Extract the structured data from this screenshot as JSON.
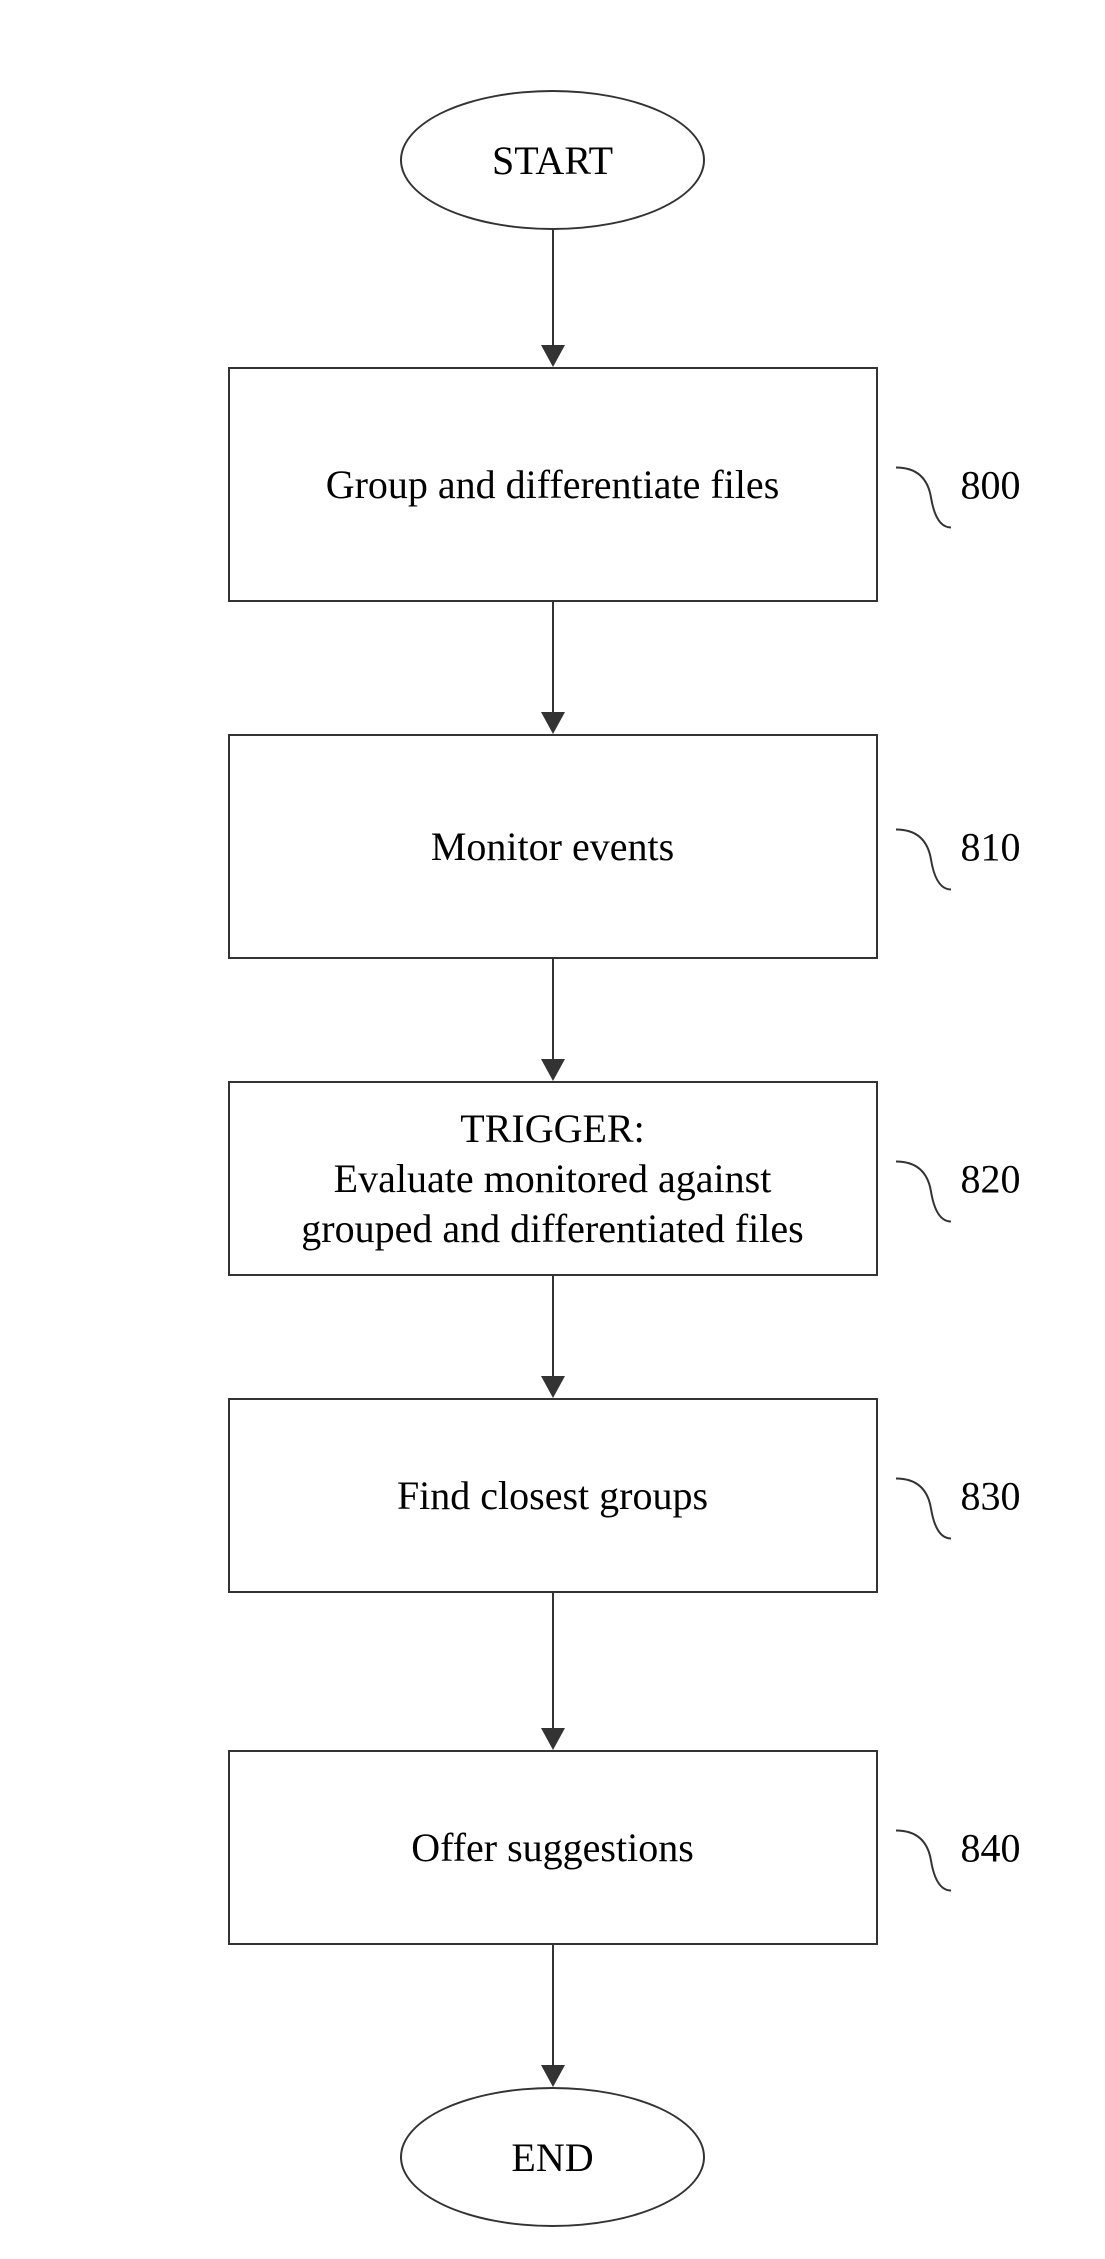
{
  "chart_data": {
    "type": "flowchart",
    "nodes": [
      {
        "id": "start",
        "type": "terminal",
        "label": "START"
      },
      {
        "id": "800",
        "type": "process",
        "label": "Group and differentiate files",
        "ref": "800"
      },
      {
        "id": "810",
        "type": "process",
        "label": "Monitor events",
        "ref": "810"
      },
      {
        "id": "820",
        "type": "process",
        "label": "TRIGGER:\nEvaluate monitored against\ngrouped and differentiated files",
        "ref": "820"
      },
      {
        "id": "830",
        "type": "process",
        "label": "Find closest groups",
        "ref": "830"
      },
      {
        "id": "840",
        "type": "process",
        "label": "Offer suggestions",
        "ref": "840"
      },
      {
        "id": "end",
        "type": "terminal",
        "label": "END"
      }
    ],
    "edges": [
      {
        "from": "start",
        "to": "800"
      },
      {
        "from": "800",
        "to": "810"
      },
      {
        "from": "810",
        "to": "820"
      },
      {
        "from": "820",
        "to": "830"
      },
      {
        "from": "830",
        "to": "840"
      },
      {
        "from": "840",
        "to": "end"
      }
    ]
  },
  "start": {
    "label": "START"
  },
  "end": {
    "label": "END"
  },
  "steps": {
    "s0": {
      "label": "Group and differentiate files",
      "ref": "800"
    },
    "s1": {
      "label": "Monitor events",
      "ref": "810"
    },
    "s2": {
      "line1": "TRIGGER:",
      "line2": "Evaluate monitored against",
      "line3": "grouped and differentiated files",
      "ref": "820"
    },
    "s3": {
      "label": "Find closest groups",
      "ref": "830"
    },
    "s4": {
      "label": "Offer suggestions",
      "ref": "840"
    }
  }
}
